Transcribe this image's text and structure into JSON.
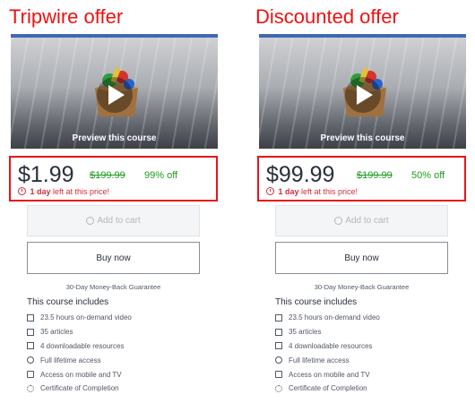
{
  "panels": [
    {
      "heading": "Tripwire offer",
      "preview_label": "Preview this course",
      "price": "$1.99",
      "original_price": "$199.99",
      "discount": "99% off",
      "timer_bold": "1 day",
      "timer_rest": " left at this price!",
      "add_to_cart": "Add to cart",
      "buy_now": "Buy now",
      "guarantee": "30-Day Money-Back Guarantee",
      "includes_title": "This course includes",
      "features": [
        {
          "icon": "video-icon",
          "text": "23.5 hours on-demand video"
        },
        {
          "icon": "file-icon",
          "text": "35 articles"
        },
        {
          "icon": "download-icon",
          "text": "4 downloadable resources"
        },
        {
          "icon": "infinity-icon",
          "text": "Full lifetime access"
        },
        {
          "icon": "mobile-icon",
          "text": "Access on mobile and TV"
        },
        {
          "icon": "certificate-icon",
          "text": "Certificate of Completion"
        }
      ]
    },
    {
      "heading": "Discounted offer",
      "preview_label": "Preview this course",
      "price": "$99.99",
      "original_price": "$199.99",
      "discount": "50% off",
      "timer_bold": "1 day",
      "timer_rest": " left at this price!",
      "add_to_cart": "Add to cart",
      "buy_now": "Buy now",
      "guarantee": "30-Day Money-Back Guarantee",
      "includes_title": "This course includes",
      "features": [
        {
          "icon": "video-icon",
          "text": "23.5 hours on-demand video"
        },
        {
          "icon": "file-icon",
          "text": "35 articles"
        },
        {
          "icon": "download-icon",
          "text": "4 downloadable resources"
        },
        {
          "icon": "infinity-icon",
          "text": "Full lifetime access"
        },
        {
          "icon": "mobile-icon",
          "text": "Access on mobile and TV"
        },
        {
          "icon": "certificate-icon",
          "text": "Certificate of Completion"
        }
      ]
    }
  ],
  "colors": {
    "heading": "#ee1111",
    "highlight_border": "#e8141a",
    "discount_green": "#1e9a1e",
    "timer_red": "#d0303a",
    "card_accent": "#4267b2"
  }
}
